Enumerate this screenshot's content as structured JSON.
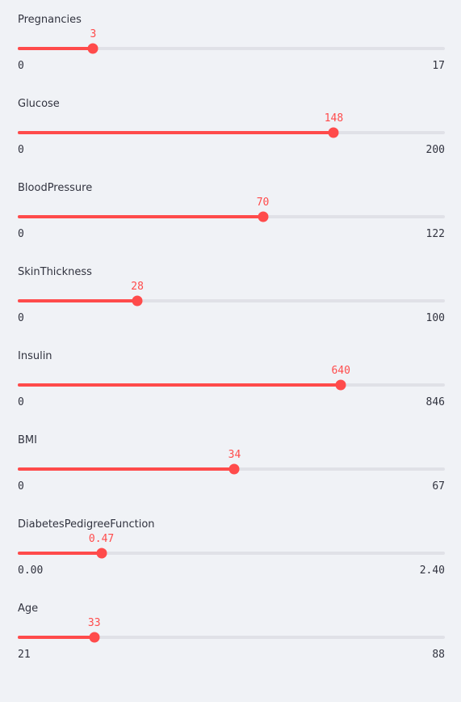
{
  "sliders": [
    {
      "label": "Pregnancies",
      "value": "3",
      "min": "0",
      "max": "17",
      "fraction": 0.1765
    },
    {
      "label": "Glucose",
      "value": "148",
      "min": "0",
      "max": "200",
      "fraction": 0.74
    },
    {
      "label": "BloodPressure",
      "value": "70",
      "min": "0",
      "max": "122",
      "fraction": 0.5738
    },
    {
      "label": "SkinThickness",
      "value": "28",
      "min": "0",
      "max": "100",
      "fraction": 0.28
    },
    {
      "label": "Insulin",
      "value": "640",
      "min": "0",
      "max": "846",
      "fraction": 0.7565
    },
    {
      "label": "BMI",
      "value": "34",
      "min": "0",
      "max": "67",
      "fraction": 0.5075
    },
    {
      "label": "DiabetesPedigreeFunction",
      "value": "0.47",
      "min": "0.00",
      "max": "2.40",
      "fraction": 0.1958
    },
    {
      "label": "Age",
      "value": "33",
      "min": "21",
      "max": "88",
      "fraction": 0.1791
    }
  ],
  "colors": {
    "accent": "#ff4b4b",
    "track": "#e0e1e7",
    "text": "#31333f",
    "background": "#f0f2f6"
  }
}
